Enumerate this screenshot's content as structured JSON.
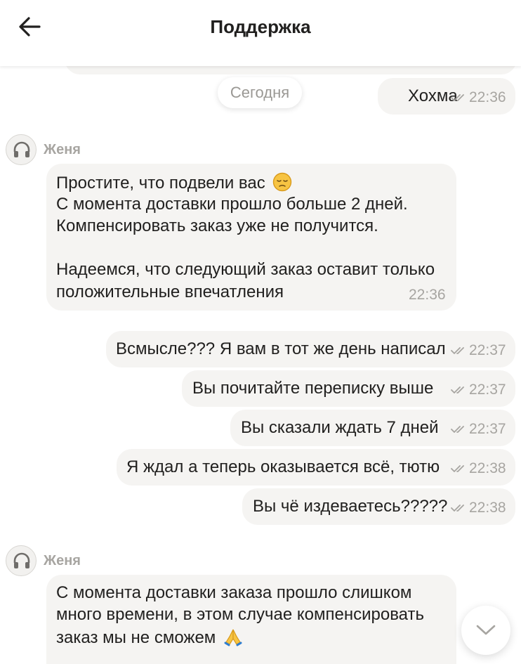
{
  "header": {
    "title": "Поддержка",
    "back_icon": "arrow-left-icon"
  },
  "date_separator": "Сегодня",
  "colors": {
    "bubble": "#f5f4f2",
    "text": "#21201f",
    "muted": "#a7a5a1"
  },
  "messages": [
    {
      "side": "out",
      "text": "Хохма",
      "time": "22:36",
      "read": true
    },
    {
      "side": "in",
      "sender": "Женя",
      "time": "22:36",
      "lines": [
        "Простите, что подвели вас",
        "С момента доставки прошло больше 2 дней.",
        "Компенсировать заказ уже не получится.",
        "",
        "Надеемся, что следующий заказ оставит только",
        "положительные впечатления"
      ],
      "emoji": "pensive-face"
    },
    {
      "side": "out",
      "text": "Всмысле??? Я вам в тот же день написал",
      "time": "22:37",
      "read": true
    },
    {
      "side": "out",
      "text": "Вы почитайте переписку выше",
      "time": "22:37",
      "read": true
    },
    {
      "side": "out",
      "text": "Вы сказали ждать 7 дней",
      "time": "22:37",
      "read": true
    },
    {
      "side": "out",
      "text": "Я ждал а теперь оказывается всё, тютю",
      "time": "22:38",
      "read": true
    },
    {
      "side": "out",
      "text": "Вы чё издеваетесь?????",
      "time": "22:38",
      "read": true
    },
    {
      "side": "in",
      "sender": "Женя",
      "lines": [
        "С момента доставки заказа прошло слишком",
        "много времени, в этом случае компенсировать",
        "заказ мы не сможем"
      ],
      "emoji": "folded-hands"
    }
  ],
  "scroll_down_icon": "chevron-down-icon"
}
